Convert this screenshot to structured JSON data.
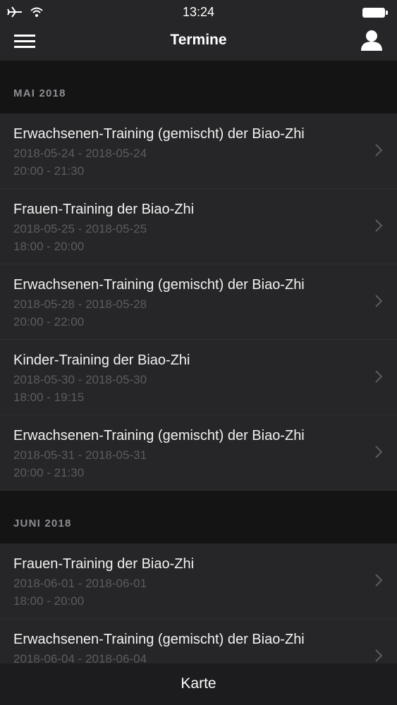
{
  "status_bar": {
    "time": "13:24"
  },
  "header": {
    "title": "Termine"
  },
  "sections": [
    {
      "label": "MAI 2018",
      "events": [
        {
          "title": "Erwachsenen-Training (gemischt) der Biao-Zhi",
          "dates": "2018-05-24 - 2018-05-24",
          "times": "20:00 - 21:30"
        },
        {
          "title": "Frauen-Training der Biao-Zhi",
          "dates": "2018-05-25 - 2018-05-25",
          "times": "18:00 - 20:00"
        },
        {
          "title": "Erwachsenen-Training (gemischt) der Biao-Zhi",
          "dates": "2018-05-28 - 2018-05-28",
          "times": "20:00 - 22:00"
        },
        {
          "title": "Kinder-Training der Biao-Zhi",
          "dates": "2018-05-30 - 2018-05-30",
          "times": "18:00 - 19:15"
        },
        {
          "title": "Erwachsenen-Training (gemischt) der Biao-Zhi",
          "dates": "2018-05-31 - 2018-05-31",
          "times": "20:00 - 21:30"
        }
      ]
    },
    {
      "label": "JUNI 2018",
      "events": [
        {
          "title": "Frauen-Training der Biao-Zhi",
          "dates": "2018-06-01 - 2018-06-01",
          "times": "18:00 - 20:00"
        },
        {
          "title": "Erwachsenen-Training (gemischt) der Biao-Zhi",
          "dates": "2018-06-04 - 2018-06-04",
          "times": ""
        }
      ]
    }
  ],
  "tabbar": {
    "label": "Karte"
  }
}
